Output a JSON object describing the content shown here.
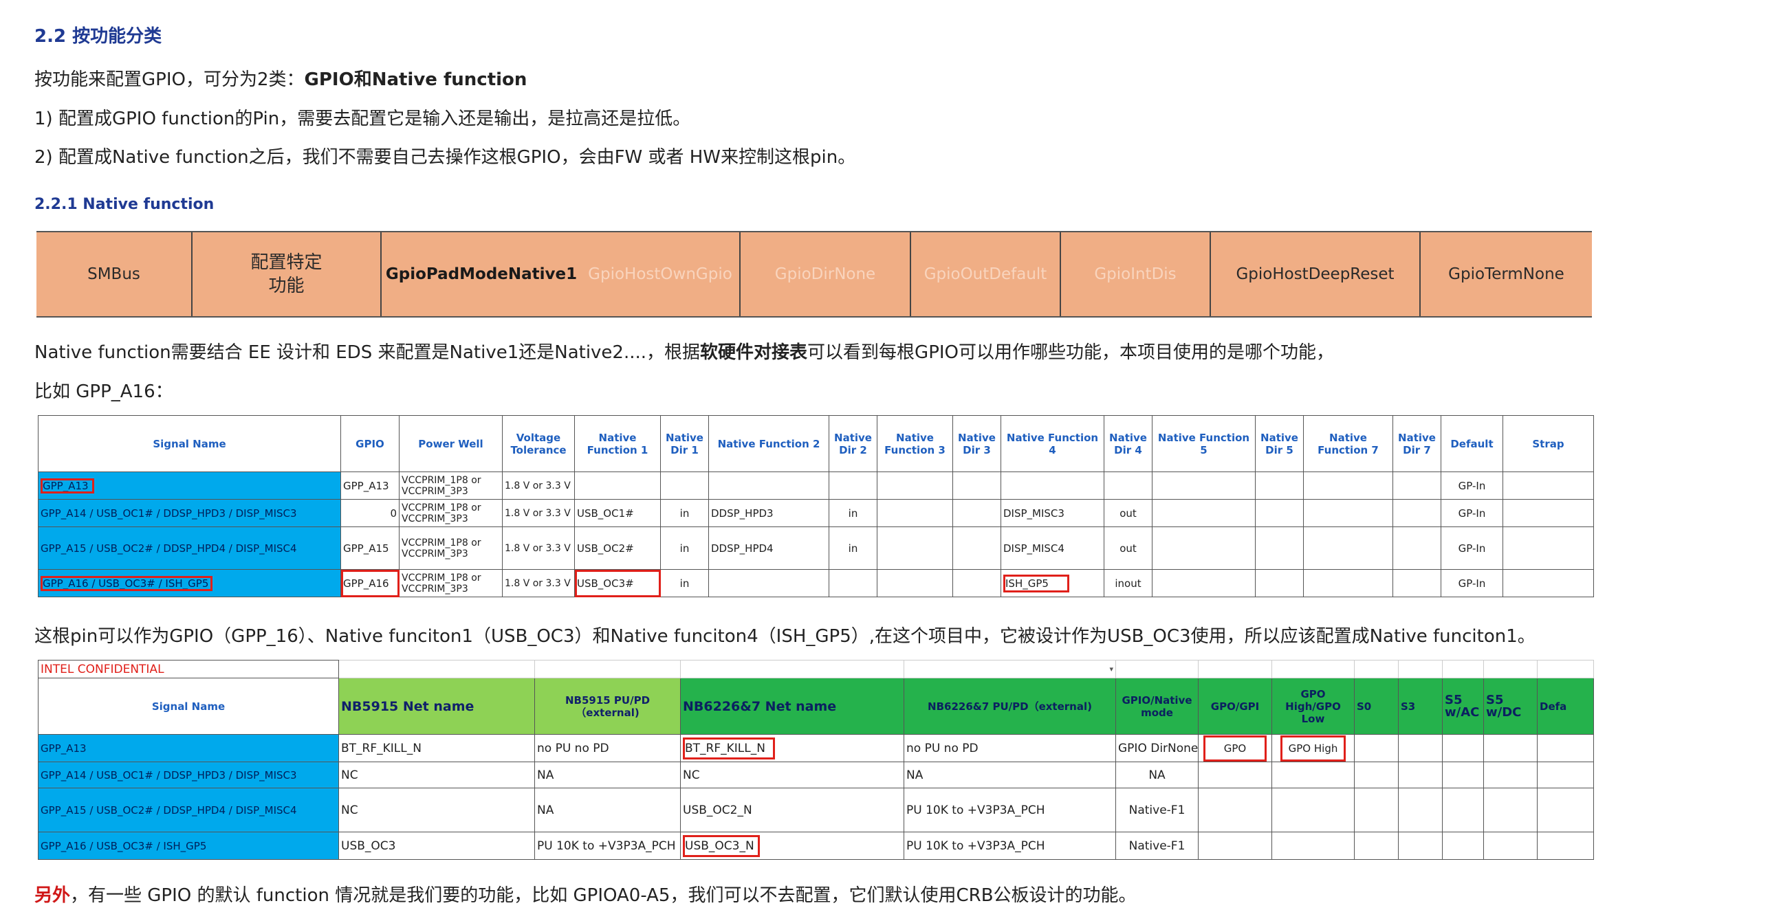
{
  "heading": "2.2 按功能分类",
  "intro": {
    "prefix": "按功能来配置GPIO，可分为2类：",
    "bold": "GPIO和Native function"
  },
  "item1": "1)    配置成GPIO function的Pin，需要去配置它是输入还是输出，是拉高还是拉低。",
  "item2": "2)    配置成Native function之后，我们不需要自己去操作这根GPIO，会由FW 或者 HW来控制这根pin。",
  "subheading": "2.2.1  Native function",
  "band": [
    "SMBus",
    "配置特定\n功能",
    "GpioPadModeNative1",
    "GpioHostOwnGpio",
    "GpioDirNone",
    "GpioOutDefault",
    "GpioIntDis",
    "GpioHostDeepReset",
    "GpioTermNone"
  ],
  "para1": {
    "a": "Native function需要结合 EE 设计和 EDS 来配置是Native1还是Native2....，根据",
    "b": "软硬件对接表",
    "c": "可以看到每根GPIO可以用作哪些功能，本项目使用的是哪个功能，"
  },
  "para2": "比如 GPP_A16：",
  "table1": {
    "headers": [
      "Signal Name",
      "GPIO",
      "Power Well",
      "Voltage Tolerance",
      "Native Function 1",
      "Native Dir 1",
      "Native Function 2",
      "Native Dir 2",
      "Native Function 3",
      "Native Dir 3",
      "Native Function 4",
      "Native Dir 4",
      "Native Function 5",
      "Native Dir 5",
      "Native Function 7",
      "Native Dir 7",
      "Default",
      "Strap"
    ],
    "rows": [
      [
        "GPP_A13",
        "GPP_A13",
        "VCCPRIM_1P8 or VCCPRIM_3P3",
        "1.8 V or 3.3 V",
        "",
        "",
        "",
        "",
        "",
        "",
        "",
        "",
        "",
        "",
        "",
        "",
        "GP-In",
        ""
      ],
      [
        "GPP_A14 / USB_OC1# / DDSP_HPD3 / DISP_MISC3",
        "0",
        "VCCPRIM_1P8 or VCCPRIM_3P3",
        "1.8 V or 3.3 V",
        "USB_OC1#",
        "in",
        "DDSP_HPD3",
        "in",
        "",
        "",
        "DISP_MISC3",
        "out",
        "",
        "",
        "",
        "",
        "GP-In",
        ""
      ],
      [
        "GPP_A15 / USB_OC2# / DDSP_HPD4 / DISP_MISC4",
        "GPP_A15",
        "VCCPRIM_1P8 or VCCPRIM_3P3",
        "1.8 V or 3.3 V",
        "USB_OC2#",
        "in",
        "DDSP_HPD4",
        "in",
        "",
        "",
        "DISP_MISC4",
        "out",
        "",
        "",
        "",
        "",
        "GP-In",
        ""
      ],
      [
        "GPP_A16 / USB_OC3# / ISH_GP5",
        "GPP_A16",
        "VCCPRIM_1P8 or VCCPRIM_3P3",
        "1.8 V or 3.3 V",
        "USB_OC3#",
        "in",
        "",
        "",
        "",
        "",
        "ISH_GP5",
        "inout",
        "",
        "",
        "",
        "",
        "GP-In",
        ""
      ]
    ]
  },
  "para3": "这根pin可以作为GPIO（GPP_16）、Native funciton1（USB_OC3）和Native funciton4（ISH_GP5）,在这个项目中，它被设计作为USB_OC3使用，所以应该配置成Native funciton1。",
  "table2": {
    "confidential": "INTEL CONFIDENTIAL",
    "headers": [
      "Signal Name",
      "NB5915 Net name",
      "NB5915 PU/PD（external)",
      "NB6226&7 Net name",
      "NB6226&7 PU/PD（external)",
      "GPIO/Native mode",
      "GPO/GPI",
      "GPO High/GPO Low",
      "S0",
      "S3",
      "S5 w/AC",
      "S5 w/DC",
      "Defa"
    ],
    "rows": [
      [
        "GPP_A13",
        "BT_RF_KILL_N",
        "no PU no PD",
        "BT_RF_KILL_N",
        "no PU no PD",
        "GPIO DirNone",
        "GPO",
        "GPO High",
        "",
        "",
        "",
        "",
        ""
      ],
      [
        "GPP_A14 / USB_OC1# / DDSP_HPD3 / DISP_MISC3",
        "NC",
        "NA",
        "NC",
        "NA",
        "NA",
        "",
        "",
        "",
        "",
        "",
        "",
        ""
      ],
      [
        "GPP_A15 / USB_OC2# / DDSP_HPD4 / DISP_MISC4",
        "NC",
        "NA",
        "USB_OC2_N",
        "PU 10K to +V3P3A_PCH",
        "Native-F1",
        "",
        "",
        "",
        "",
        "",
        "",
        ""
      ],
      [
        "GPP_A16 / USB_OC3# / ISH_GP5",
        "USB_OC3",
        "PU 10K to +V3P3A_PCH",
        "USB_OC3_N",
        "PU 10K to +V3P3A_PCH",
        "Native-F1",
        "",
        "",
        "",
        "",
        "",
        "",
        ""
      ]
    ]
  },
  "footer": {
    "a": "另外",
    "b": "，有一些 GPIO 的默认 function 情况就是我们要的功能，比如 GPIOA0-A5，我们可以不去配置，它们默认使用CRB公板设计的功能。"
  },
  "colors": {
    "heading": "#1f3a93",
    "band": "#f0ae85",
    "signal_cell": "#00a9ec",
    "green_header": "#8ed255",
    "green_header_dark": "#25b24c",
    "highlight": "#e0201a"
  }
}
